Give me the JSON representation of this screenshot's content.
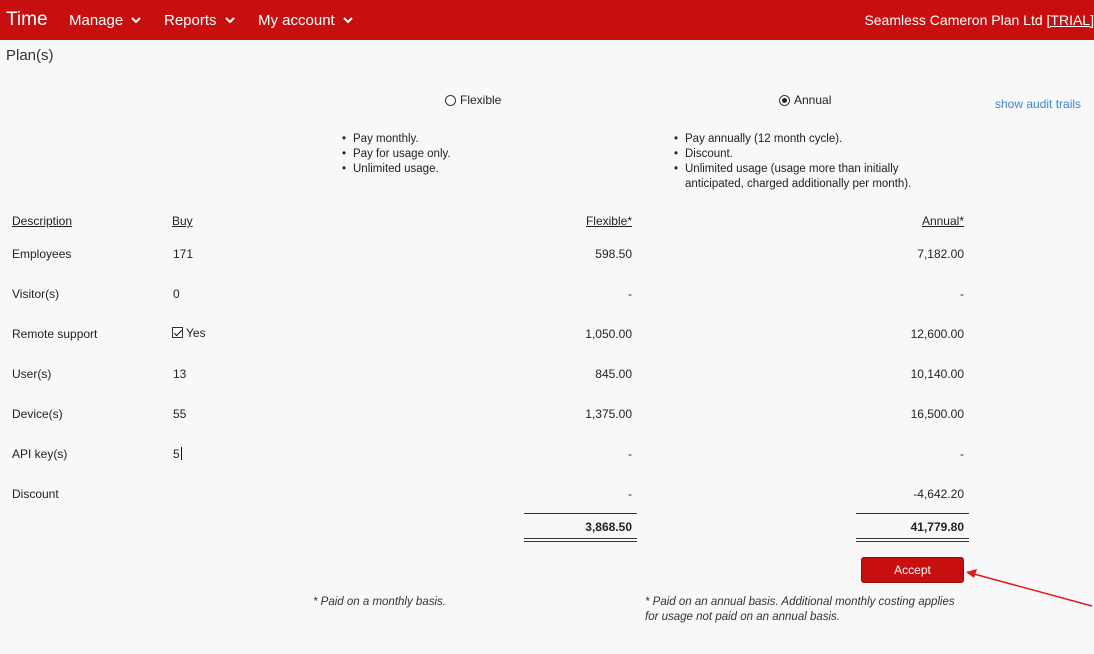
{
  "topbar": {
    "brand": "Time",
    "nav": [
      {
        "label": "Manage"
      },
      {
        "label": "Reports"
      },
      {
        "label": "My account"
      }
    ],
    "company": "Seamless Cameron Plan Ltd",
    "trial": "[TRIAL]"
  },
  "page": {
    "title": "Plan(s)"
  },
  "plans": {
    "flexible": {
      "label": "Flexible",
      "selected": false,
      "bullets": [
        "Pay monthly.",
        "Pay for usage only.",
        "Unlimited usage."
      ]
    },
    "annual": {
      "label": "Annual",
      "selected": true,
      "bullets": [
        "Pay annually (12 month cycle).",
        "Discount.",
        "Unlimited usage (usage more than initially anticipated, charged additionally per month)."
      ]
    }
  },
  "audit_link": "show audit trails",
  "table": {
    "headers": {
      "description": "Description",
      "buy": "Buy",
      "flexible": "Flexible*",
      "annual": "Annual*"
    },
    "rows": [
      {
        "description": "Employees",
        "buy": "171",
        "flexible": "598.50",
        "annual": "7,182.00"
      },
      {
        "description": "Visitor(s)",
        "buy": "0",
        "flexible": "-",
        "annual": "-"
      },
      {
        "description": "Remote support",
        "buy": "Yes",
        "buy_checked": true,
        "flexible": "1,050.00",
        "annual": "12,600.00"
      },
      {
        "description": "User(s)",
        "buy": "13",
        "flexible": "845.00",
        "annual": "10,140.00"
      },
      {
        "description": "Device(s)",
        "buy": "55",
        "flexible": "1,375.00",
        "annual": "16,500.00"
      },
      {
        "description": "API key(s)",
        "buy": "5",
        "flexible": "-",
        "annual": "-"
      },
      {
        "description": "Discount",
        "buy": "",
        "flexible": "-",
        "annual": "-4,642.20"
      }
    ],
    "totals": {
      "flexible": "3,868.50",
      "annual": "41,779.80"
    }
  },
  "accept_label": "Accept",
  "notes": {
    "flexible": "* Paid on a monthly basis.",
    "annual": "* Paid on an annual basis. Additional monthly costing applies for usage not paid on an annual basis."
  },
  "colors": {
    "brand": "#c70f0f",
    "link": "#3a87d6",
    "annotation_arrow": "#e01b1b"
  }
}
